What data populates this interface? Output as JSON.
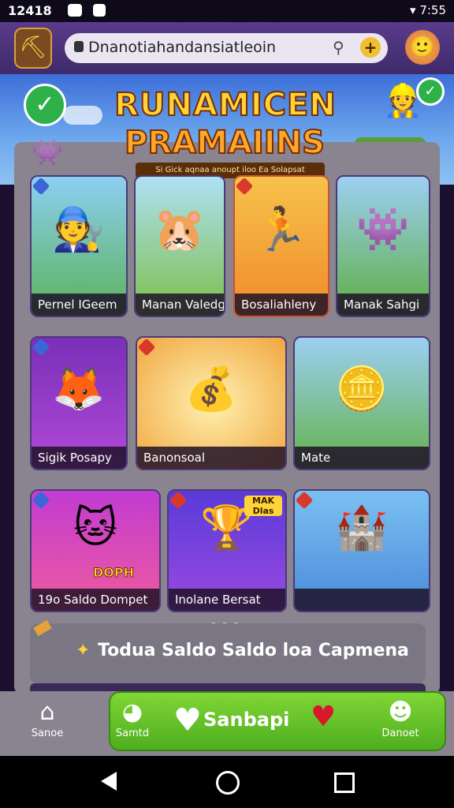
{
  "status_bar": {
    "time": "12418",
    "right": "▾ 7:55"
  },
  "header": {
    "url": "Dnanotiahandansiatleoin",
    "left_avatar_icon": "miner-avatar-icon",
    "right_avatar_icon": "character-avatar-icon"
  },
  "banner": {
    "title_line1": "RUNAMICEN",
    "title_line2": "PRAMAIINS",
    "subtitle": "Si Gick aqnaa anoupt iloo Ea Solapsat"
  },
  "games": [
    {
      "label": "Pernel IGeem",
      "emoji": "🧑‍🔧"
    },
    {
      "label": "Manan Valedg",
      "emoji": "🐹"
    },
    {
      "label": "Bosaliahleny",
      "emoji": "🏃"
    },
    {
      "label": "Manak Sahgi",
      "emoji": "👾"
    },
    {
      "label": "Sigik Posapy",
      "emoji": "🦊"
    },
    {
      "label": "Banonsoal",
      "emoji": "💰"
    },
    {
      "label": "Mate",
      "emoji": "🪙"
    },
    {
      "label": "19o Saldo Dompet",
      "emoji": "🐱"
    },
    {
      "label": "Inolane Bersat",
      "emoji": "🏆"
    },
    {
      "label": "",
      "emoji": "🏰"
    }
  ],
  "small_card_text": {
    "card7_sign": "DOPH",
    "card8_sign": "MAK Dlas"
  },
  "promo": {
    "text": "Todua Saldo Saldo loa Capmena"
  },
  "bottom_nav": {
    "home": "Sanoe",
    "saved": "Samtd",
    "main_button": "Sanbapi",
    "account": "Danoet"
  },
  "colors": {
    "accent_green": "#4fae1e",
    "brand_purple": "#3e2a6b",
    "title_yellow": "#ffd43a"
  }
}
